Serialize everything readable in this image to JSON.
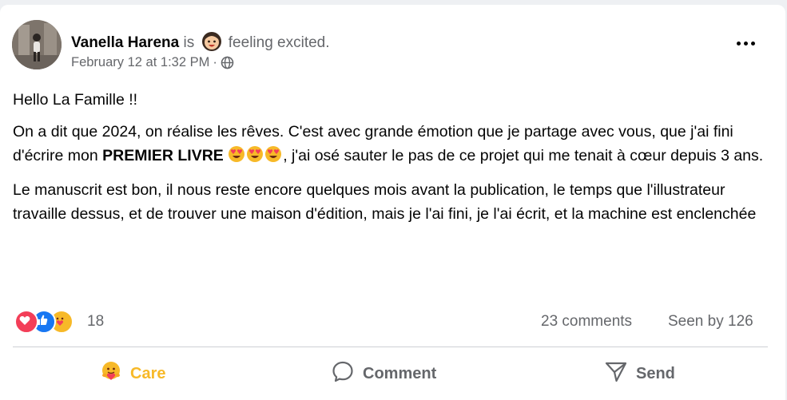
{
  "post": {
    "author": "Vanella Harena",
    "is_text": "is",
    "feeling_text": "feeling excited.",
    "timestamp": "February 12 at 1:32 PM",
    "separator": "·",
    "privacy_icon": "globe-icon",
    "greeting": "Hello La Famille !!",
    "para1_a": "On a dit que 2024, on réalise les rêves. C'est avec grande émotion que je partage avec vous, que j'ai fini d'écrire mon ",
    "para1_bold": "PREMIER LIVRE",
    "para1_b": ", j'ai osé sauter le pas de ce projet qui me tenait à cœur depuis 3 ans.",
    "para2": "Le manuscrit est bon, il nous reste encore quelques mois avant la publication, le temps que l'illustrateur travaille dessus, et de trouver une maison d'édition, mais je l'ai fini, je l'ai écrit, et la machine est enclenchée"
  },
  "stats": {
    "reactions_count": "18",
    "reaction_types": [
      "love",
      "like",
      "care"
    ],
    "comments": "23 comments",
    "seen": "Seen by 126"
  },
  "actions": {
    "care_label": "Care",
    "comment_label": "Comment",
    "send_label": "Send"
  },
  "colors": {
    "care": "#f7b928",
    "love": "#f33e58",
    "like": "#1877f2",
    "secondary_text": "#65676b"
  }
}
